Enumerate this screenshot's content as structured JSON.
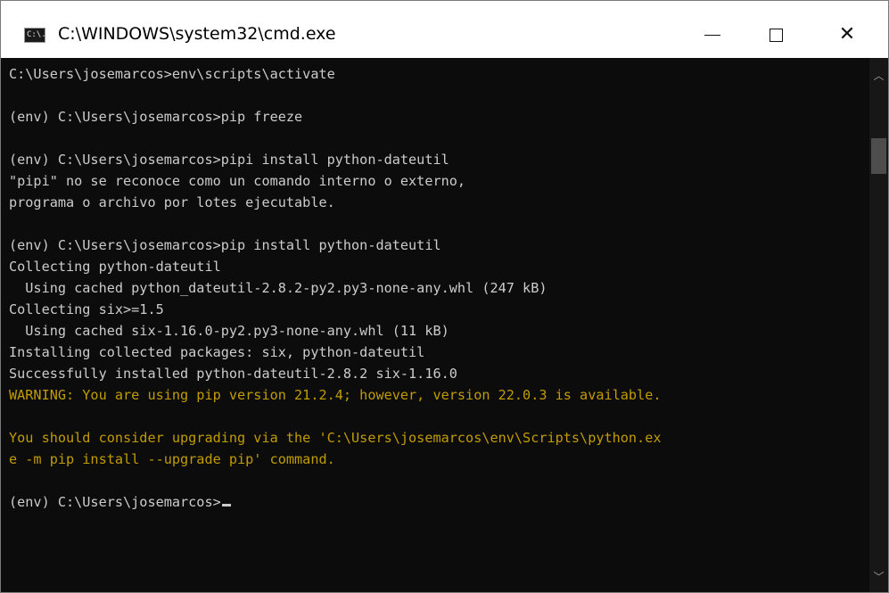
{
  "window": {
    "title": "C:\\WINDOWS\\system32\\cmd.exe",
    "icon": "cmd-icon",
    "icon_text": "C:\\.",
    "controls": {
      "minimize_icon": "minimize-icon",
      "maximize_icon": "maximize-icon",
      "close_icon": "close-icon",
      "close_glyph": "✕"
    }
  },
  "console": {
    "colors": {
      "background": "#0c0c0c",
      "text": "#cccccc",
      "warning": "#c19c00"
    },
    "lines": [
      {
        "text": "C:\\Users\\josemarcos>env\\scripts\\activate",
        "kind": "normal"
      },
      {
        "text": "",
        "kind": "normal"
      },
      {
        "text": "(env) C:\\Users\\josemarcos>pip freeze",
        "kind": "normal"
      },
      {
        "text": "",
        "kind": "normal"
      },
      {
        "text": "(env) C:\\Users\\josemarcos>pipi install python-dateutil",
        "kind": "normal"
      },
      {
        "text": "\"pipi\" no se reconoce como un comando interno o externo,",
        "kind": "normal"
      },
      {
        "text": "programa o archivo por lotes ejecutable.",
        "kind": "normal"
      },
      {
        "text": "",
        "kind": "normal"
      },
      {
        "text": "(env) C:\\Users\\josemarcos>pip install python-dateutil",
        "kind": "normal"
      },
      {
        "text": "Collecting python-dateutil",
        "kind": "normal"
      },
      {
        "text": "  Using cached python_dateutil-2.8.2-py2.py3-none-any.whl (247 kB)",
        "kind": "normal"
      },
      {
        "text": "Collecting six>=1.5",
        "kind": "normal"
      },
      {
        "text": "  Using cached six-1.16.0-py2.py3-none-any.whl (11 kB)",
        "kind": "normal"
      },
      {
        "text": "Installing collected packages: six, python-dateutil",
        "kind": "normal"
      },
      {
        "text": "Successfully installed python-dateutil-2.8.2 six-1.16.0",
        "kind": "normal"
      },
      {
        "text": "WARNING: You are using pip version 21.2.4; however, version 22.0.3 is available.",
        "kind": "warn"
      },
      {
        "text": "",
        "kind": "normal"
      },
      {
        "text": "You should consider upgrading via the 'C:\\Users\\josemarcos\\env\\Scripts\\python.ex",
        "kind": "warn"
      },
      {
        "text": "e -m pip install --upgrade pip' command.",
        "kind": "warn"
      },
      {
        "text": "",
        "kind": "normal"
      },
      {
        "text": "(env) C:\\Users\\josemarcos>",
        "kind": "prompt"
      }
    ]
  },
  "scrollbar": {
    "up_icon": "scroll-up-arrow-icon",
    "down_icon": "scroll-down-arrow-icon",
    "up_glyph": "︿",
    "down_glyph": "﹀"
  }
}
